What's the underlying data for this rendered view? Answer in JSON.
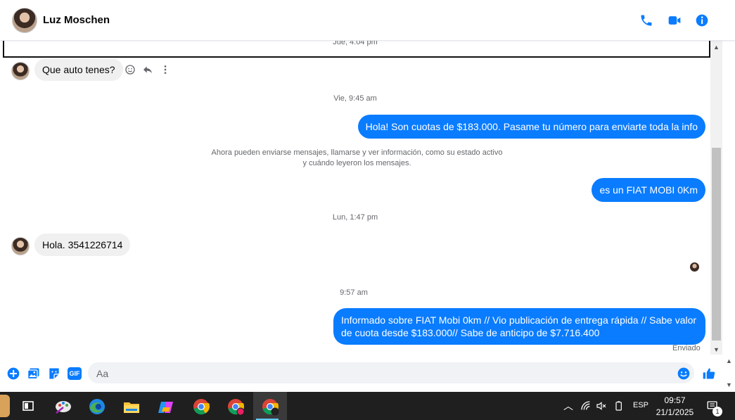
{
  "header": {
    "contact_name": "Luz Moschen",
    "icons": [
      "phone-icon",
      "video-camera-icon",
      "info-icon"
    ],
    "accent_color": "#0a7cff"
  },
  "conversation": {
    "timestamps": [
      "Jue, 4:04 pm",
      "Vie, 9:45 am",
      "Lun, 1:47 pm",
      "9:57 am"
    ],
    "messages": [
      {
        "direction": "in",
        "text": "Que auto tenes?"
      },
      {
        "direction": "out",
        "text": "Hola! Son cuotas de $183.000. Pasame tu número para enviarte toda la info"
      },
      {
        "direction": "out",
        "text": "es un FIAT MOBI 0Km"
      },
      {
        "direction": "in",
        "text": "Hola. 3541226714"
      },
      {
        "direction": "out",
        "text_line1": "Informado sobre FIAT Mobi 0km // Vio publicación de entrega rápida // Sabe valor",
        "text_line2": "de cuota desde $183.000// Sabe de anticipo de $7.716.400"
      }
    ],
    "system_message": {
      "line1": "Ahora pueden enviarse mensajes, llamarse y ver información, como su estado activo",
      "line2": "y cuándo leyeron los mensajes."
    },
    "status": "Enviado",
    "message_actions": [
      "react-icon",
      "reply-icon",
      "more-icon"
    ]
  },
  "composer": {
    "placeholder": "Aa",
    "icons": [
      "plus-icon",
      "photo-icon",
      "sticker-icon",
      "gif-icon",
      "emoji-icon",
      "like-icon"
    ],
    "gif_label": "GIF"
  },
  "taskbar": {
    "apps": [
      "task-view-icon",
      "paint-icon",
      "edge-icon",
      "file-explorer-icon",
      "copilot-icon",
      "chrome-icon",
      "chrome-profile-icon",
      "chrome-profile-2-icon"
    ],
    "tray": {
      "language": "ESP",
      "time": "09:57",
      "date": "21/1/2025",
      "notification_count": "1"
    }
  }
}
